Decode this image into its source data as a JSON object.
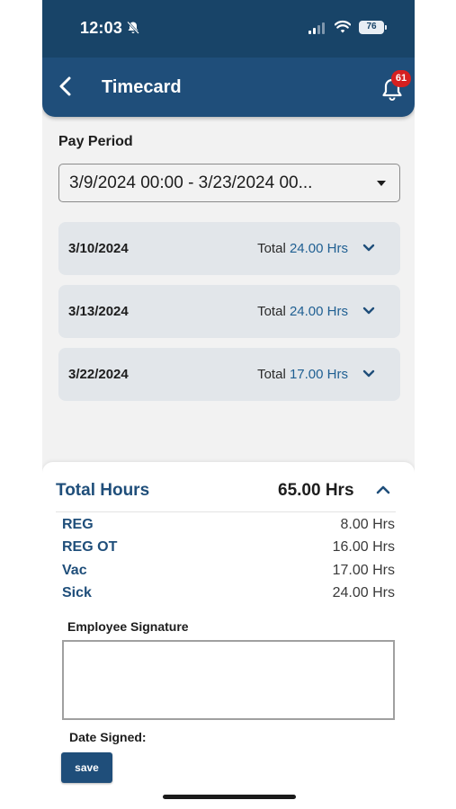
{
  "status_bar": {
    "time": "12:03",
    "battery": "76",
    "icons": [
      "bell-mute-icon",
      "signal-icon",
      "wifi-icon",
      "battery-icon"
    ]
  },
  "header": {
    "title": "Timecard",
    "back_icon": "chevron-left-icon",
    "notification_icon": "bell-icon",
    "notification_count": "61"
  },
  "pay_period": {
    "label": "Pay Period",
    "selected": "3/9/2024 00:00 - 3/23/2024 00..."
  },
  "days": [
    {
      "date": "3/10/2024",
      "total_label": "Total",
      "hours": "24.00 Hrs"
    },
    {
      "date": "3/13/2024",
      "total_label": "Total",
      "hours": "24.00 Hrs"
    },
    {
      "date": "3/22/2024",
      "total_label": "Total",
      "hours": "17.00 Hrs"
    }
  ],
  "summary": {
    "total_label": "Total Hours",
    "total_value": "65.00 Hrs",
    "rows": [
      {
        "type": "REG",
        "value": "8.00 Hrs"
      },
      {
        "type": "REG OT",
        "value": "16.00 Hrs"
      },
      {
        "type": "Vac",
        "value": "17.00 Hrs"
      },
      {
        "type": "Sick",
        "value": "24.00 Hrs"
      }
    ],
    "signature_label": "Employee Signature",
    "date_signed_label": "Date Signed:",
    "save_label": "save"
  },
  "colors": {
    "header": "#1f4e7a",
    "status_bar": "#184468",
    "accent_text": "#1f5f92",
    "badge": "#d62020",
    "card": "#e2e6ea"
  }
}
